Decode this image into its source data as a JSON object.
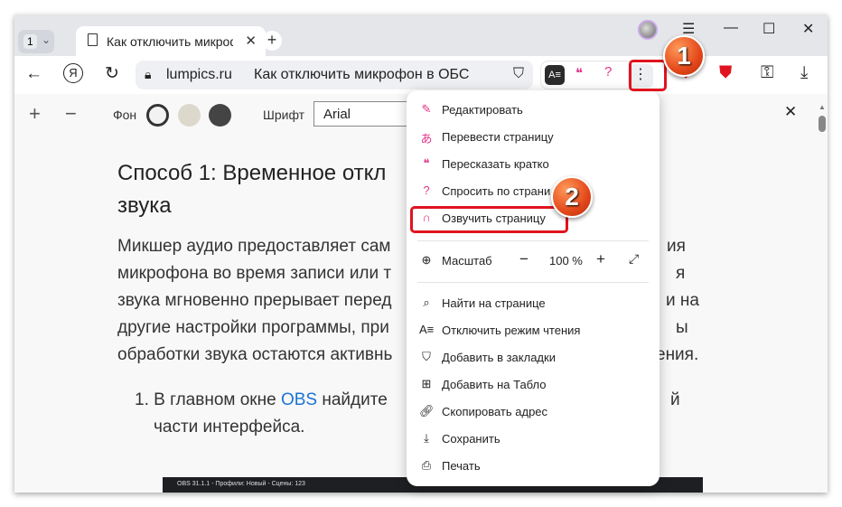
{
  "browser": {
    "tab_count": "1",
    "tab_title": "Как отключить микрофон в ОБС",
    "url_host": "lumpics.ru",
    "url_title": "Как отключить микрофон в ОБС"
  },
  "reader": {
    "bg_label": "Фон",
    "font_label": "Шрифт",
    "font_value": "Arial",
    "bg_colors": [
      "#ffffff",
      "#ddd8cc",
      "#444444"
    ]
  },
  "article": {
    "heading": [
      "Способ 1: Временное откл",
      "звука"
    ],
    "para_left": [
      "Микшер аудио предоставляет сам",
      "микрофона во время записи или т",
      "звука мгновенно прерывает перед",
      "другие настройки программы, при",
      "обработки звука остаются активнь"
    ],
    "para_right": [
      "ия",
      "я",
      "и на",
      "ы",
      "ения."
    ],
    "list_item": {
      "prefix": "1. В главном окне ",
      "link": "OBS",
      "middle": " найдите",
      "end": "й",
      "line2": "части интерфейса."
    },
    "obs_window_title": "OBS 31.1.1 - Профили: Новый - Сцены: 123"
  },
  "menu": {
    "items_top": [
      {
        "label": "Редактировать",
        "icon": "edit-sparkle-icon"
      },
      {
        "label": "Перевести страницу",
        "icon": "translate-icon"
      },
      {
        "label": "Пересказать кратко",
        "icon": "summary-icon"
      },
      {
        "label": "Спросить по страни",
        "icon": "ask-icon"
      },
      {
        "label": "Озвучить страницу",
        "icon": "headphones-icon"
      }
    ],
    "zoom": {
      "label": "Масштаб",
      "value": "100 %",
      "minus": "−",
      "plus": "+"
    },
    "items_bottom": [
      {
        "label": "Найти на странице",
        "icon": "search-icon"
      },
      {
        "label": "Отключить режим чтения",
        "icon": "reader-mode-icon"
      },
      {
        "label": "Добавить в закладки",
        "icon": "bookmark-icon"
      },
      {
        "label": "Добавить на Табло",
        "icon": "tableau-icon"
      },
      {
        "label": "Скопировать адрес",
        "icon": "link-icon"
      },
      {
        "label": "Сохранить",
        "icon": "download-icon"
      },
      {
        "label": "Печать",
        "icon": "print-icon"
      }
    ]
  },
  "callouts": [
    "1",
    "2"
  ],
  "colors": {
    "accent_pink": "#e2358a",
    "callout": "#e4481a",
    "highlight": "#e0141e",
    "link": "#1b73d6"
  }
}
